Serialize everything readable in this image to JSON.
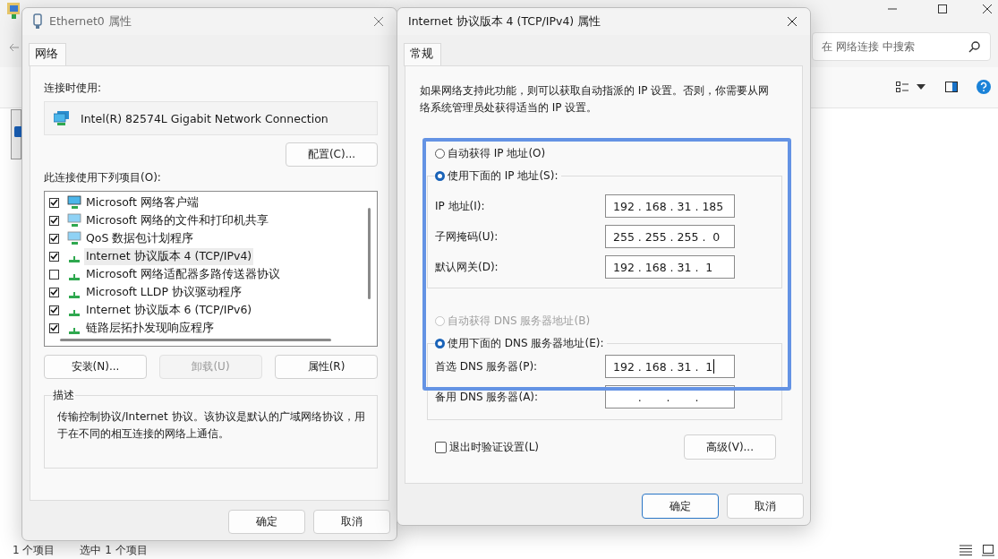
{
  "explorer": {
    "search": {
      "placeholder": "在 网络连接 中搜索"
    },
    "status_bar": [
      "1 个项目",
      "选中 1 个项目"
    ]
  },
  "adapter_dialog": {
    "title": "Ethernet0 属性",
    "tabs": [
      {
        "label": "网络",
        "selected": true
      }
    ],
    "connect_using_label": "连接时使用:",
    "adapter_name": "Intel(R) 82574L Gigabit Network Connection",
    "configure_button": "配置(C)...",
    "items_label": "此连接使用下列项目(O):",
    "items": [
      {
        "kind": "client",
        "label": "Microsoft 网络客户端",
        "checked": true,
        "selected": false
      },
      {
        "kind": "service",
        "label": "Microsoft 网络的文件和打印机共享",
        "checked": true,
        "selected": false
      },
      {
        "kind": "service",
        "label": "QoS 数据包计划程序",
        "checked": true,
        "selected": false
      },
      {
        "kind": "protocol",
        "label": "Internet 协议版本 4 (TCP/IPv4)",
        "checked": true,
        "selected": true
      },
      {
        "kind": "protocol",
        "label": "Microsoft 网络适配器多路传送器协议",
        "checked": false,
        "selected": false
      },
      {
        "kind": "protocol",
        "label": "Microsoft LLDP 协议驱动程序",
        "checked": true,
        "selected": false
      },
      {
        "kind": "protocol",
        "label": "Internet 协议版本 6 (TCP/IPv6)",
        "checked": true,
        "selected": false
      },
      {
        "kind": "protocol",
        "label": "链路层拓扑发现响应程序",
        "checked": true,
        "selected": false
      }
    ],
    "buttons": [
      {
        "label": "安装(N)...",
        "disabled": false
      },
      {
        "label": "卸载(U)",
        "disabled": true
      },
      {
        "label": "属性(R)",
        "disabled": false
      }
    ],
    "description": {
      "title": "描述",
      "text": "传输控制协议/Internet 协议。该协议是默认的广域网络协议，用于在不同的相互连接的网络上通信。"
    },
    "footer_buttons": [
      {
        "label": "确定",
        "default": false
      },
      {
        "label": "取消",
        "default": false
      }
    ]
  },
  "ipv4_dialog": {
    "title": "Internet 协议版本 4 (TCP/IPv4) 属性",
    "tabs": [
      {
        "label": "常规",
        "selected": true
      }
    ],
    "intro": "如果网络支持此功能，则可以获取自动指派的 IP 设置。否则，你需要从网络系统管理员处获得适当的 IP 设置。",
    "ip_modes": [
      {
        "label": "自动获得 IP 地址(O)",
        "selected": false,
        "disabled": false
      },
      {
        "label": "使用下面的 IP 地址(S):",
        "selected": true,
        "disabled": false
      }
    ],
    "ip_fields": [
      {
        "label": "IP 地址(I):",
        "value": "192 . 168 . 31 . 185",
        "focused": false
      },
      {
        "label": "子网掩码(U):",
        "value": "255 . 255 . 255 .  0",
        "focused": false
      },
      {
        "label": "默认网关(D):",
        "value": "192 . 168 . 31 .  1",
        "focused": false
      }
    ],
    "dns_modes": [
      {
        "label": "自动获得 DNS 服务器地址(B)",
        "selected": false,
        "disabled": true
      },
      {
        "label": "使用下面的 DNS 服务器地址(E):",
        "selected": true,
        "disabled": false
      }
    ],
    "dns_fields": [
      {
        "label": "首选 DNS 服务器(P):",
        "value": "192 . 168 . 31 .  1",
        "focused": true
      },
      {
        "label": "备用 DNS 服务器(A):",
        "value": "       .       .       .",
        "focused": false
      }
    ],
    "validate": {
      "label": "退出时验证设置(L)",
      "checked": false
    },
    "advanced_button": "高级(V)...",
    "footer_buttons": [
      {
        "label": "确定",
        "default": true
      },
      {
        "label": "取消",
        "default": false
      }
    ]
  }
}
